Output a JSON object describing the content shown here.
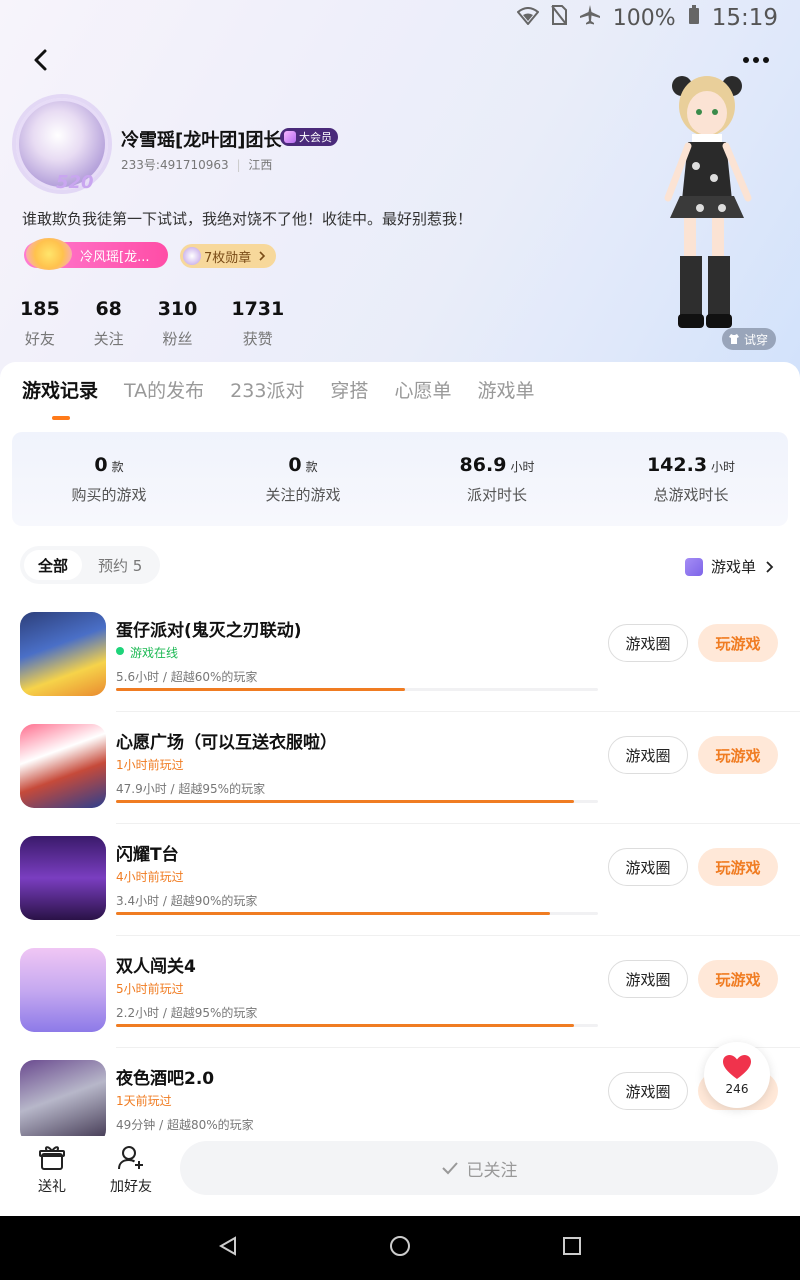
{
  "status": {
    "battery": "100%",
    "time": "15:19"
  },
  "profile": {
    "name": "冷雪瑶[龙叶团]团长",
    "vip_label": "大会员",
    "uid": "233号:491710963",
    "region": "江西",
    "avatar_badge": "520",
    "bio": "谁敢欺负我徒第一下试试，我绝对饶不了他！收徒中。最好别惹我！",
    "pet_chip": "冷风瑶[龙...",
    "medals_chip": "7枚勋章",
    "try_on": "试穿"
  },
  "stats": [
    {
      "value": "185",
      "label": "好友"
    },
    {
      "value": "68",
      "label": "关注"
    },
    {
      "value": "310",
      "label": "粉丝"
    },
    {
      "value": "1731",
      "label": "获赞"
    }
  ],
  "tabs": [
    "游戏记录",
    "TA的发布",
    "233派对",
    "穿搭",
    "心愿单",
    "游戏单"
  ],
  "summary": [
    {
      "value": "0",
      "unit": "款",
      "label": "购买的游戏"
    },
    {
      "value": "0",
      "unit": "款",
      "label": "关注的游戏"
    },
    {
      "value": "86.9",
      "unit": "小时",
      "label": "派对时长"
    },
    {
      "value": "142.3",
      "unit": "小时",
      "label": "总游戏时长"
    }
  ],
  "filters": {
    "all": "全部",
    "reserve": "预约 5",
    "gamelist": "游戏单"
  },
  "games": [
    {
      "title": "蛋仔派对(鬼灭之刃联动)",
      "status": "游戏在线",
      "online": true,
      "meta": "5.6小时 / 超越60%的玩家",
      "progress": 0.6
    },
    {
      "title": "心愿广场（可以互送衣服啦）",
      "status": "1小时前玩过",
      "online": false,
      "meta": "47.9小时 / 超越95%的玩家",
      "progress": 0.95
    },
    {
      "title": "闪耀T台",
      "status": "4小时前玩过",
      "online": false,
      "meta": "3.4小时 / 超越90%的玩家",
      "progress": 0.9
    },
    {
      "title": "双人闯关4",
      "status": "5小时前玩过",
      "online": false,
      "meta": "2.2小时 / 超越95%的玩家",
      "progress": 0.95
    },
    {
      "title": "夜色酒吧2.0",
      "status": "1天前玩过",
      "online": false,
      "meta": "49分钟 / 超越80%的玩家",
      "progress": 0.8
    }
  ],
  "buttons": {
    "circle": "游戏圈",
    "play": "玩游戏"
  },
  "likes": "246",
  "bottom": {
    "gift": "送礼",
    "add_friend": "加好友",
    "followed": "已关注"
  }
}
